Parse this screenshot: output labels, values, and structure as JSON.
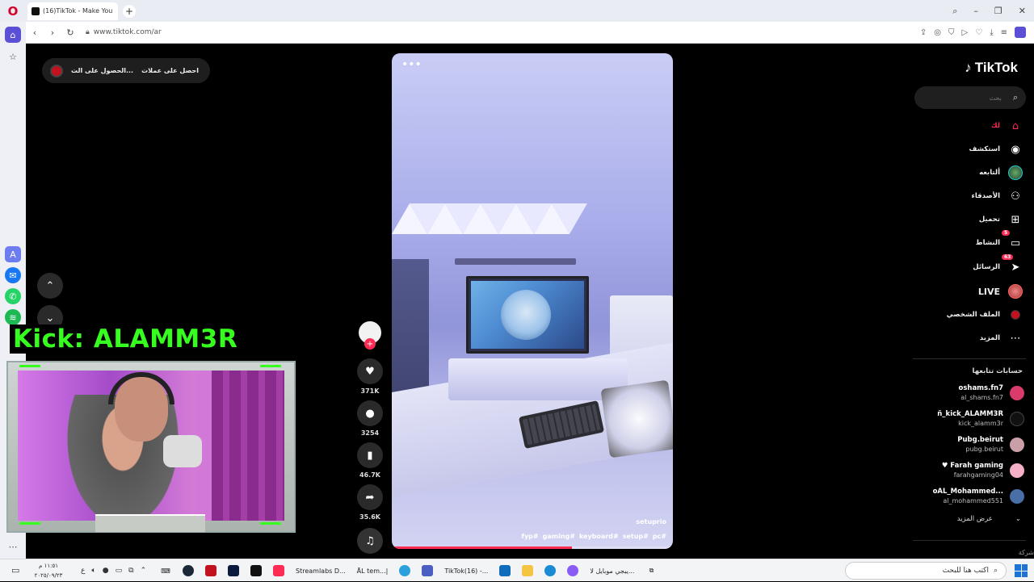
{
  "browser": {
    "tab_title": "(16)TikTok - Make You",
    "new_tab_label": "+",
    "url": "www.tiktok.com/ar",
    "nav": {
      "back": "‹",
      "forward": "›",
      "reload": "↻"
    },
    "window": {
      "search": "⌕",
      "minimize": "–",
      "restore": "❐",
      "close": "✕"
    }
  },
  "page": {
    "top_pill": {
      "coins": "احصل على عملات",
      "app": "الحصول على الت..."
    },
    "video": {
      "menu": "•••",
      "author": "setuprio",
      "tags": [
        "fyp#",
        "gaming#",
        "keyboard#",
        "setup#",
        "pc#"
      ],
      "progress_fraction": 0.64
    },
    "actions": {
      "likes": "371K",
      "comments": "3254",
      "saves": "46.7K",
      "shares": "35.6K"
    },
    "logo": "TikTok",
    "search_placeholder": "بحث",
    "nav": [
      {
        "label": "لك",
        "icon": "home-icon",
        "active": true
      },
      {
        "label": "استكشف",
        "icon": "compass-icon"
      },
      {
        "label": "ألتابعه",
        "icon": "following-avatar-icon"
      },
      {
        "label": "الأصدقاء",
        "icon": "friends-icon"
      },
      {
        "label": "تحميل",
        "icon": "upload-icon"
      },
      {
        "label": "النشاط",
        "icon": "activity-icon",
        "badge": "5"
      },
      {
        "label": "الرسائل",
        "icon": "messages-icon",
        "badge": "63"
      },
      {
        "label": "LIVE",
        "icon": "live-icon"
      },
      {
        "label": "الملف الشخصي",
        "icon": "profile-icon"
      },
      {
        "label": "المزيد",
        "icon": "more-icon"
      }
    ],
    "following_title": "حسابات تتابعها",
    "following": [
      {
        "name": "οshams.fn7",
        "handle": "al_shams.fn7",
        "color": "#d93b6b"
      },
      {
        "name": "ñ_kick_ALAMM3R",
        "handle": "kick_alamm3r",
        "color": "#111111"
      },
      {
        "name": "Pubg.beirut",
        "handle": "pubg.beirut",
        "color": "#c9a0a8"
      },
      {
        "name": "♥ Farah gaming",
        "handle": "farahgaming04",
        "color": "#f5b0c8"
      },
      {
        "name": "οAL_Mohammed...",
        "handle": "al_mohammed551",
        "color": "#4a6fa8"
      }
    ],
    "see_more": "عرض المزيد",
    "company": "شركة"
  },
  "stream": {
    "kick_label": "Kick: ALAMM3R"
  },
  "taskbar": {
    "time": "١١:٥١ م",
    "date": "٢٠٢٥/٠٩/٢٣",
    "lang": "ع",
    "apps": [
      {
        "label": "Streamlabs D...",
        "color": "#333333"
      },
      {
        "label": "ĀL tem...|",
        "color": "#6b3fbf"
      },
      {
        "label": "TikTok(16) -...",
        "color": "#d4002b"
      },
      {
        "label": "يبجي موبايل لا...",
        "color": "#2a7de1"
      }
    ],
    "search_placeholder": "اكتب هنا للبحث"
  }
}
